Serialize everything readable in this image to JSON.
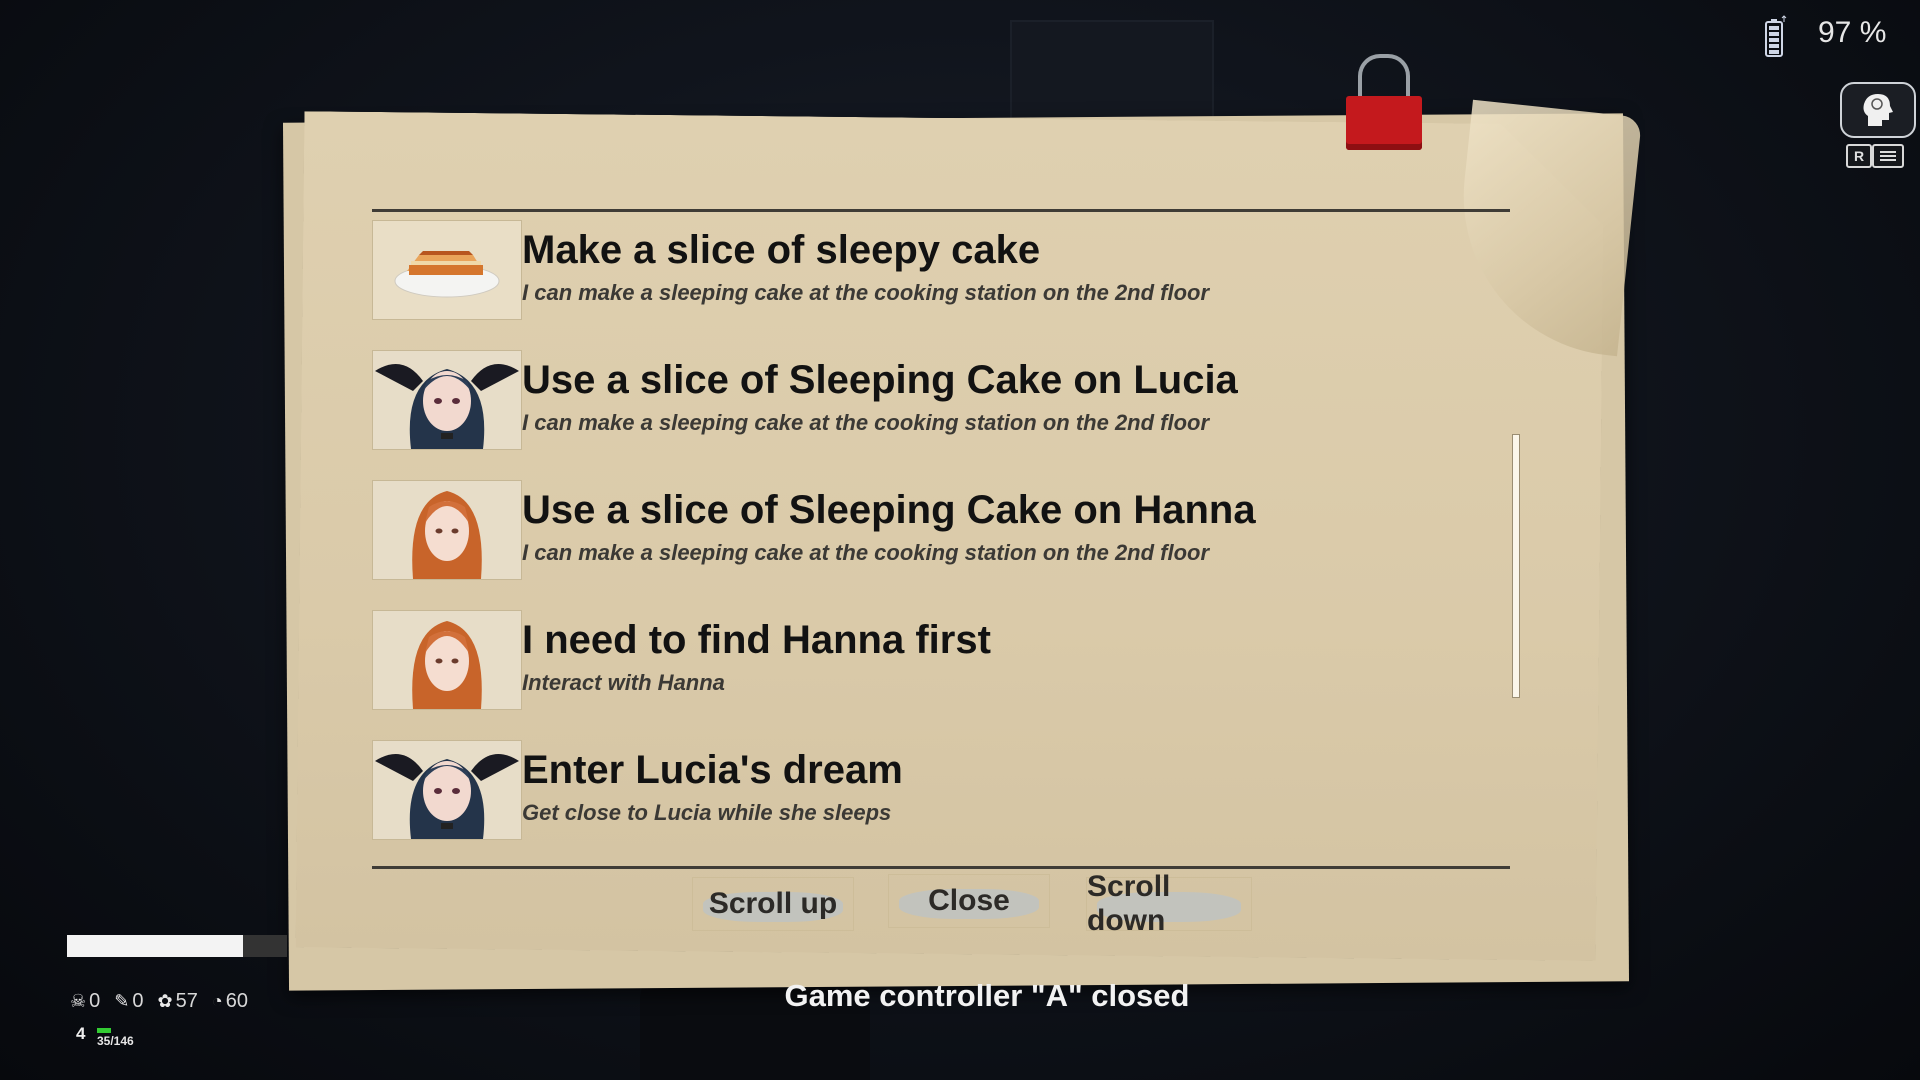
{
  "status": {
    "battery_percent_label": "97 %",
    "message": "Game controller \"A\" closed"
  },
  "quests": [
    {
      "title": "Make a slice of sleepy cake",
      "desc": "I can make a sleeping cake at the cooking station on the 2nd floor",
      "thumb_icon": "cake-icon"
    },
    {
      "title": "Use a slice of Sleeping Cake on Lucia",
      "desc": "I can make a sleeping cake at the cooking station on the 2nd floor",
      "thumb_icon": "lucia-portrait"
    },
    {
      "title": "Use a slice of Sleeping Cake on Hanna",
      "desc": "I can make a sleeping cake at the cooking station on the 2nd floor",
      "thumb_icon": "hanna-portrait"
    },
    {
      "title": "I need to find Hanna first",
      "desc": "Interact with Hanna",
      "thumb_icon": "hanna-portrait"
    },
    {
      "title": "Enter Lucia's dream",
      "desc": "Get close to Lucia while she sleeps",
      "thumb_icon": "lucia-portrait"
    }
  ],
  "buttons": {
    "scroll_up": "Scroll up",
    "close": "Close",
    "scroll_down": "Scroll down"
  },
  "hud": {
    "key_r": "R",
    "kills": "0",
    "items": "0",
    "coins": "57",
    "clock": "60",
    "level": "4",
    "xp": "35/146",
    "hp_fraction": 0.8
  },
  "colors": {
    "paper": "#dacaa9",
    "clip": "#c4191d",
    "xp_green": "#33cc33"
  }
}
